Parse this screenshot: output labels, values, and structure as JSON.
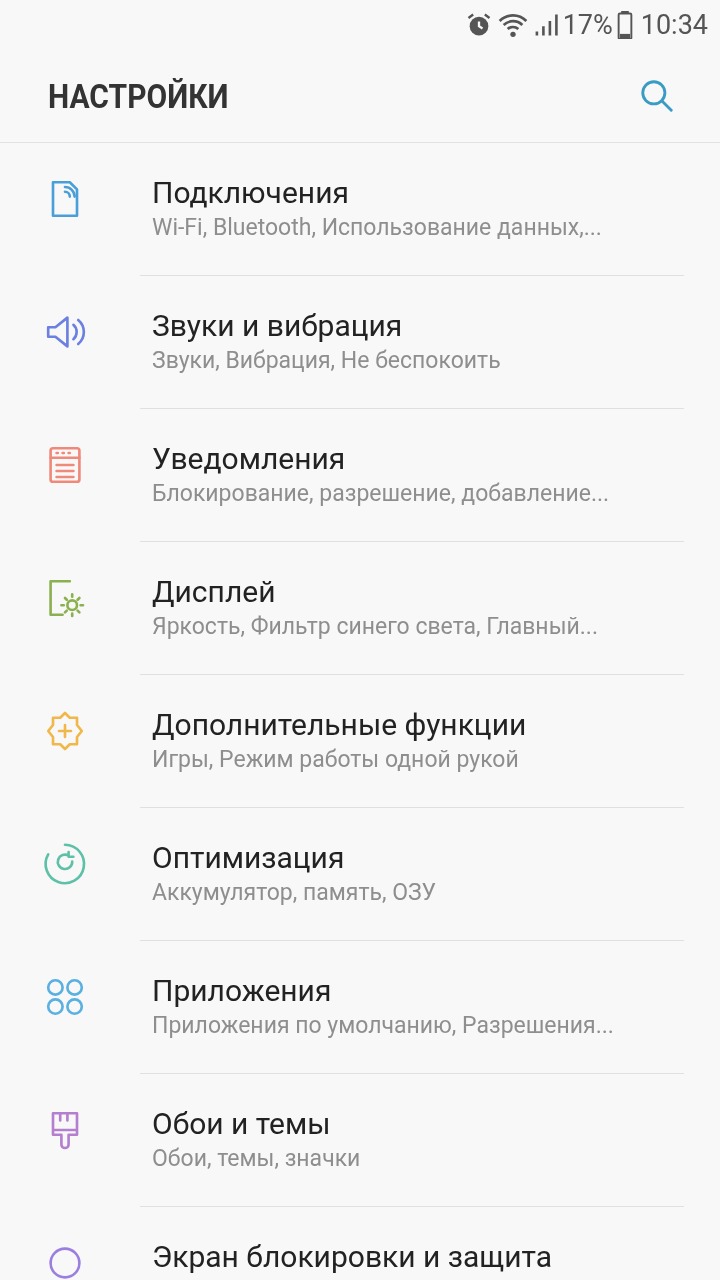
{
  "status_bar": {
    "battery_text": "17%",
    "time": "10:34"
  },
  "header": {
    "title": "НАСТРОЙКИ"
  },
  "items": [
    {
      "title": "Подключения",
      "subtitle": "Wi-Fi, Bluetooth, Использование данных,...",
      "color": "#4a9fd8"
    },
    {
      "title": "Звуки и вибрация",
      "subtitle": "Звуки, Вибрация, Не беспокоить",
      "color": "#6b80e0"
    },
    {
      "title": "Уведомления",
      "subtitle": "Блокирование, разрешение, добавление...",
      "color": "#ef8a7a"
    },
    {
      "title": "Дисплей",
      "subtitle": "Яркость, Фильтр синего света, Главный...",
      "color": "#8bb04f"
    },
    {
      "title": "Дополнительные функции",
      "subtitle": "Игры, Режим работы одной рукой",
      "color": "#f0b84a"
    },
    {
      "title": "Оптимизация",
      "subtitle": "Аккумулятор, память, ОЗУ",
      "color": "#5fc0a8"
    },
    {
      "title": "Приложения",
      "subtitle": "Приложения по умолчанию, Разрешения...",
      "color": "#5ab0e0"
    },
    {
      "title": "Обои и темы",
      "subtitle": "Обои, темы, значки",
      "color": "#b57fd0"
    },
    {
      "title": "Экран блокировки и защита",
      "color": "#9b7fe0"
    }
  ]
}
